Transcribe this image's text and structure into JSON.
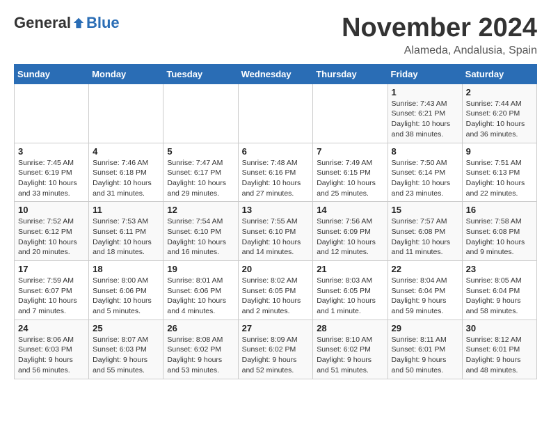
{
  "logo": {
    "general": "General",
    "blue": "Blue"
  },
  "title": {
    "month": "November 2024",
    "location": "Alameda, Andalusia, Spain"
  },
  "calendar": {
    "headers": [
      "Sunday",
      "Monday",
      "Tuesday",
      "Wednesday",
      "Thursday",
      "Friday",
      "Saturday"
    ],
    "weeks": [
      [
        {
          "day": "",
          "info": ""
        },
        {
          "day": "",
          "info": ""
        },
        {
          "day": "",
          "info": ""
        },
        {
          "day": "",
          "info": ""
        },
        {
          "day": "",
          "info": ""
        },
        {
          "day": "1",
          "info": "Sunrise: 7:43 AM\nSunset: 6:21 PM\nDaylight: 10 hours\nand 38 minutes."
        },
        {
          "day": "2",
          "info": "Sunrise: 7:44 AM\nSunset: 6:20 PM\nDaylight: 10 hours\nand 36 minutes."
        }
      ],
      [
        {
          "day": "3",
          "info": "Sunrise: 7:45 AM\nSunset: 6:19 PM\nDaylight: 10 hours\nand 33 minutes."
        },
        {
          "day": "4",
          "info": "Sunrise: 7:46 AM\nSunset: 6:18 PM\nDaylight: 10 hours\nand 31 minutes."
        },
        {
          "day": "5",
          "info": "Sunrise: 7:47 AM\nSunset: 6:17 PM\nDaylight: 10 hours\nand 29 minutes."
        },
        {
          "day": "6",
          "info": "Sunrise: 7:48 AM\nSunset: 6:16 PM\nDaylight: 10 hours\nand 27 minutes."
        },
        {
          "day": "7",
          "info": "Sunrise: 7:49 AM\nSunset: 6:15 PM\nDaylight: 10 hours\nand 25 minutes."
        },
        {
          "day": "8",
          "info": "Sunrise: 7:50 AM\nSunset: 6:14 PM\nDaylight: 10 hours\nand 23 minutes."
        },
        {
          "day": "9",
          "info": "Sunrise: 7:51 AM\nSunset: 6:13 PM\nDaylight: 10 hours\nand 22 minutes."
        }
      ],
      [
        {
          "day": "10",
          "info": "Sunrise: 7:52 AM\nSunset: 6:12 PM\nDaylight: 10 hours\nand 20 minutes."
        },
        {
          "day": "11",
          "info": "Sunrise: 7:53 AM\nSunset: 6:11 PM\nDaylight: 10 hours\nand 18 minutes."
        },
        {
          "day": "12",
          "info": "Sunrise: 7:54 AM\nSunset: 6:10 PM\nDaylight: 10 hours\nand 16 minutes."
        },
        {
          "day": "13",
          "info": "Sunrise: 7:55 AM\nSunset: 6:10 PM\nDaylight: 10 hours\nand 14 minutes."
        },
        {
          "day": "14",
          "info": "Sunrise: 7:56 AM\nSunset: 6:09 PM\nDaylight: 10 hours\nand 12 minutes."
        },
        {
          "day": "15",
          "info": "Sunrise: 7:57 AM\nSunset: 6:08 PM\nDaylight: 10 hours\nand 11 minutes."
        },
        {
          "day": "16",
          "info": "Sunrise: 7:58 AM\nSunset: 6:08 PM\nDaylight: 10 hours\nand 9 minutes."
        }
      ],
      [
        {
          "day": "17",
          "info": "Sunrise: 7:59 AM\nSunset: 6:07 PM\nDaylight: 10 hours\nand 7 minutes."
        },
        {
          "day": "18",
          "info": "Sunrise: 8:00 AM\nSunset: 6:06 PM\nDaylight: 10 hours\nand 5 minutes."
        },
        {
          "day": "19",
          "info": "Sunrise: 8:01 AM\nSunset: 6:06 PM\nDaylight: 10 hours\nand 4 minutes."
        },
        {
          "day": "20",
          "info": "Sunrise: 8:02 AM\nSunset: 6:05 PM\nDaylight: 10 hours\nand 2 minutes."
        },
        {
          "day": "21",
          "info": "Sunrise: 8:03 AM\nSunset: 6:05 PM\nDaylight: 10 hours\nand 1 minute."
        },
        {
          "day": "22",
          "info": "Sunrise: 8:04 AM\nSunset: 6:04 PM\nDaylight: 9 hours\nand 59 minutes."
        },
        {
          "day": "23",
          "info": "Sunrise: 8:05 AM\nSunset: 6:04 PM\nDaylight: 9 hours\nand 58 minutes."
        }
      ],
      [
        {
          "day": "24",
          "info": "Sunrise: 8:06 AM\nSunset: 6:03 PM\nDaylight: 9 hours\nand 56 minutes."
        },
        {
          "day": "25",
          "info": "Sunrise: 8:07 AM\nSunset: 6:03 PM\nDaylight: 9 hours\nand 55 minutes."
        },
        {
          "day": "26",
          "info": "Sunrise: 8:08 AM\nSunset: 6:02 PM\nDaylight: 9 hours\nand 53 minutes."
        },
        {
          "day": "27",
          "info": "Sunrise: 8:09 AM\nSunset: 6:02 PM\nDaylight: 9 hours\nand 52 minutes."
        },
        {
          "day": "28",
          "info": "Sunrise: 8:10 AM\nSunset: 6:02 PM\nDaylight: 9 hours\nand 51 minutes."
        },
        {
          "day": "29",
          "info": "Sunrise: 8:11 AM\nSunset: 6:01 PM\nDaylight: 9 hours\nand 50 minutes."
        },
        {
          "day": "30",
          "info": "Sunrise: 8:12 AM\nSunset: 6:01 PM\nDaylight: 9 hours\nand 48 minutes."
        }
      ]
    ]
  }
}
